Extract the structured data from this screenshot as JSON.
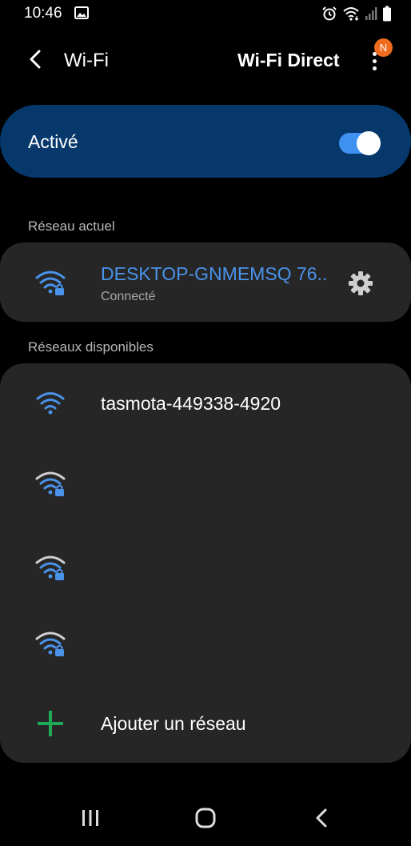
{
  "status_bar": {
    "time": "10:46",
    "left_icons": [
      "image-icon"
    ],
    "right_icons": [
      "alarm-icon",
      "wifi-status-icon",
      "signal-icon",
      "battery-icon"
    ]
  },
  "header": {
    "title": "Wi-Fi",
    "wifi_direct_label": "Wi-Fi Direct",
    "notification_badge": "N"
  },
  "master_toggle": {
    "label": "Activé",
    "enabled": true
  },
  "current_network": {
    "section_label": "Réseau actuel",
    "name": "DESKTOP-GNMEMSQ 76..",
    "status": "Connecté",
    "secured": true
  },
  "available_networks": {
    "section_label": "Réseaux disponibles",
    "items": [
      {
        "name": "tasmota-449338-4920",
        "secured": false
      },
      {
        "name": "",
        "secured": true
      },
      {
        "name": "",
        "secured": true
      },
      {
        "name": "",
        "secured": true
      }
    ],
    "add_network_label": "Ajouter un réseau"
  },
  "nav_bar": {
    "icons": [
      "recent-apps-icon",
      "home-icon",
      "back-nav-icon"
    ]
  },
  "colors": {
    "background": "#000000",
    "toggle_card": "#07386b",
    "accent_blue": "#4a93ea",
    "card": "#262626",
    "add_green": "#1faa59",
    "badge": "#ef6c1f"
  }
}
